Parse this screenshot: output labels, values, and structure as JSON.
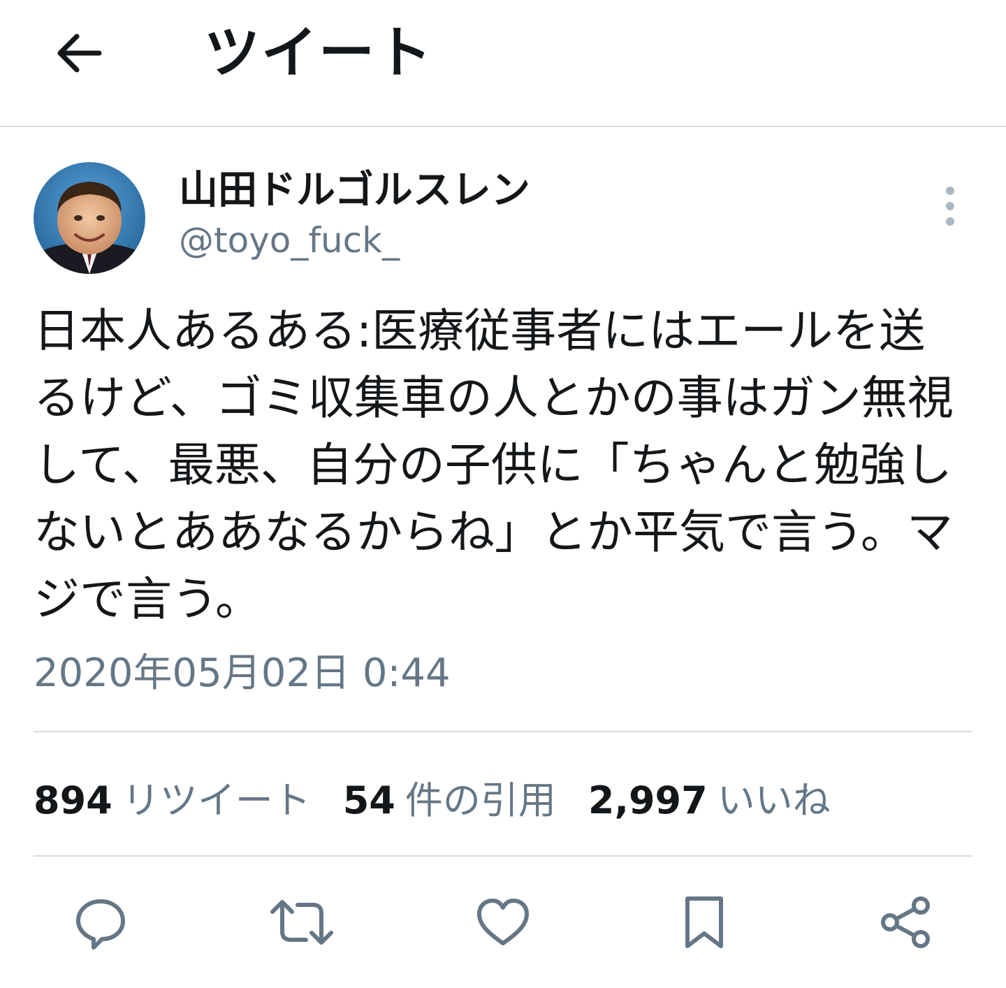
{
  "header": {
    "title": "ツイート",
    "back_icon": "arrow-left-icon"
  },
  "tweet": {
    "display_name": "山田ドルゴルスレン",
    "handle": "@toyo_fuck_",
    "text": "日本人あるある:医療従事者にはエールを送るけど、ゴミ収集車の人とかの事はガン無視して、最悪、自分の子供に「ちゃんと勉強しないとああなるからね」とか平気で言う。マジで言う。",
    "timestamp": "2020年05月02日 0:44"
  },
  "stats": {
    "retweets_count": "894",
    "retweets_label": "リツイート",
    "quotes_count": "54",
    "quotes_label": "件の引用",
    "likes_count": "2,997",
    "likes_label": "いいね"
  },
  "actions": [
    {
      "icon": "reply-icon"
    },
    {
      "icon": "retweet-icon"
    },
    {
      "icon": "like-icon"
    },
    {
      "icon": "bookmark-icon"
    },
    {
      "icon": "share-icon"
    }
  ],
  "colors": {
    "text_primary": "#14171a",
    "text_secondary": "#657786",
    "divider": "#d8dde1",
    "icon": "#657786"
  }
}
